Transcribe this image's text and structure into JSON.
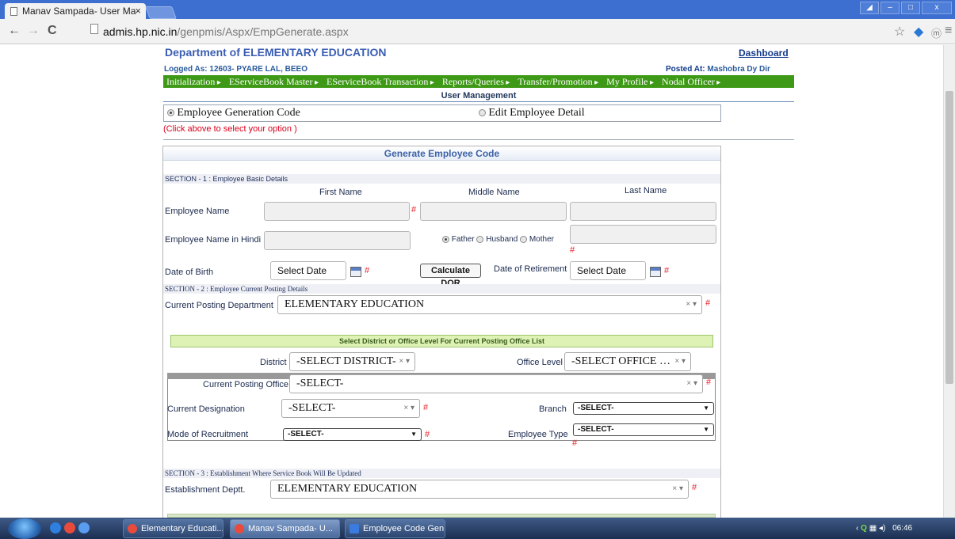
{
  "browser": {
    "tab_title": "Manav Sampada- User Ma",
    "tab_close": "×",
    "url_host": "admis.hp.nic.in",
    "url_path": "/genpmis/Aspx/EmpGenerate.aspx",
    "icons": [
      "back-arrow-icon",
      "forward-arrow-icon",
      "reload-icon",
      "star-icon",
      "extension-icon",
      "profile-icon",
      "menu-icon"
    ]
  },
  "header": {
    "dept_title": "Department of ELEMENTARY EDUCATION",
    "dashboard": "Dashboard",
    "logged_as": "Logged As: 12603- PYARE LAL, BEEO",
    "posted_label": "Posted At:",
    "posted_value": "Mashobra Dy Dir"
  },
  "menu": [
    "Initialization",
    "EServiceBook Master",
    "EServiceBook Transaction",
    "Reports/Queries",
    "Transfer/Promotion",
    "My Profile",
    "Nodal Officer"
  ],
  "page_title": "User Management",
  "options": {
    "employee_generation": "Employee Generation Code",
    "edit_employee": "Edit Employee Detail",
    "selected": "employee_generation",
    "hint": "(Click above to select your option )"
  },
  "form": {
    "title": "Generate Employee Code",
    "section1": "SECTION - 1 : Employee Basic Details",
    "col_first": "First Name",
    "col_middle": "Middle Name",
    "col_last": "Last Name",
    "employee_name": "Employee Name",
    "employee_name_hindi": "Employee Name in Hindi",
    "relation_father": "Father",
    "relation_husband": "Husband",
    "relation_mother": "Mother",
    "relation_selected": "Father",
    "dob": "Date of Birth",
    "select_date": "Select Date",
    "calc_dor": "Calculate DOR",
    "dor": "Date of Retirement",
    "req": "#",
    "section2": "SECTION - 2 : Employee Current Posting Details",
    "current_posting_department": "Current Posting Department",
    "department_value": "ELEMENTARY EDUCATION",
    "office_list_head": "Select District or Office Level For Current Posting Office List",
    "district": "District",
    "district_value": "-SELECT DISTRICT-",
    "office_level": "Office Level",
    "office_level_value": "-SELECT OFFICE …",
    "current_posting_office": "Current Posting Office",
    "office_value": "-SELECT-",
    "current_designation": "Current Designation",
    "designation_value": "-SELECT-",
    "branch": "Branch",
    "branch_value": "-SELECT-",
    "mode_of_recruitment": "Mode of Recruitment",
    "mode_value": "-SELECT-",
    "employee_type": "Employee Type",
    "employee_type_value": "-SELECT-",
    "section3": "SECTION - 3 : Establishment Where Service Book Will Be Updated",
    "establishment_deptt": "Establishment Deptt.",
    "establishment_value": "ELEMENTARY EDUCATION",
    "select2_controls": "× ▾"
  },
  "taskbar": {
    "tasks": [
      "Elementary Educati...",
      "Manav Sampada- U...",
      "Employee Code Gen..."
    ],
    "time": "06:46"
  }
}
